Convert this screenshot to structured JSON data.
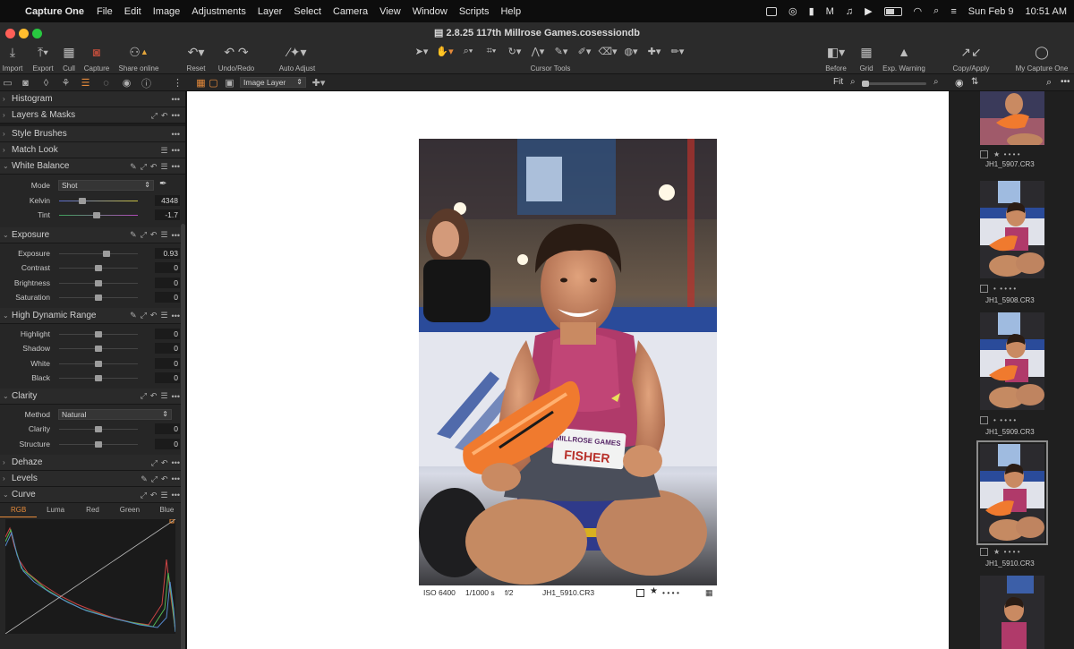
{
  "menubar": {
    "app": "Capture One",
    "items": [
      "File",
      "Edit",
      "Image",
      "Adjustments",
      "Layer",
      "Select",
      "Camera",
      "View",
      "Window",
      "Scripts",
      "Help"
    ],
    "date": "Sun Feb 9",
    "time": "10:51 AM"
  },
  "window": {
    "title": "2.8.25 117th Millrose Games.cosessiondb"
  },
  "toolbar": {
    "import": "Import",
    "export": "Export",
    "cull": "Cull",
    "capture": "Capture",
    "share_online": "Share online",
    "reset": "Reset",
    "undo_redo": "Undo/Redo",
    "auto_adjust": "Auto Adjust",
    "cursor_tools": "Cursor Tools",
    "before": "Before",
    "grid": "Grid",
    "exp_warning": "Exp. Warning",
    "copy_apply": "Copy/Apply",
    "my_capture_one": "My Capture One"
  },
  "viewer_bar": {
    "layer_select": "Image Layer",
    "fit": "Fit"
  },
  "panels": {
    "histogram": "Histogram",
    "layers_masks": "Layers & Masks",
    "style_brushes": "Style Brushes",
    "match_look": "Match Look",
    "white_balance": {
      "title": "White Balance",
      "mode_label": "Mode",
      "mode_value": "Shot",
      "kelvin_label": "Kelvin",
      "kelvin_value": "4348",
      "kelvin_pos": 0.3,
      "tint_label": "Tint",
      "tint_value": "-1.7",
      "tint_pos": 0.48
    },
    "exposure": {
      "title": "Exposure",
      "rows": [
        {
          "label": "Exposure",
          "value": "0.93",
          "pos": 0.6
        },
        {
          "label": "Contrast",
          "value": "0",
          "pos": 0.5
        },
        {
          "label": "Brightness",
          "value": "0",
          "pos": 0.5
        },
        {
          "label": "Saturation",
          "value": "0",
          "pos": 0.5
        }
      ]
    },
    "hdr": {
      "title": "High Dynamic Range",
      "rows": [
        {
          "label": "Highlight",
          "value": "0",
          "pos": 0.5
        },
        {
          "label": "Shadow",
          "value": "0",
          "pos": 0.5
        },
        {
          "label": "White",
          "value": "0",
          "pos": 0.5
        },
        {
          "label": "Black",
          "value": "0",
          "pos": 0.5
        }
      ]
    },
    "clarity": {
      "title": "Clarity",
      "method_label": "Method",
      "method_value": "Natural",
      "rows": [
        {
          "label": "Clarity",
          "value": "0",
          "pos": 0.5
        },
        {
          "label": "Structure",
          "value": "0",
          "pos": 0.5
        }
      ]
    },
    "dehaze": "Dehaze",
    "levels": "Levels",
    "curve": {
      "title": "Curve",
      "tabs": [
        "RGB",
        "Luma",
        "Red",
        "Green",
        "Blue"
      ]
    }
  },
  "photo_caption": {
    "iso": "ISO 6400",
    "shutter": "1/1000 s",
    "aperture": "f/2",
    "filename": "JH1_5910.CR3",
    "rating_star": "★",
    "rating_dots": "• • • •"
  },
  "photo_content": {
    "bib_line1": "MILLROSE GAMES",
    "bib_name": "FISHER"
  },
  "browser": {
    "thumbs": [
      {
        "name": "JH1_5907.CR3",
        "star": "★",
        "dots": "• • • •"
      },
      {
        "name": "JH1_5908.CR3",
        "star": "•",
        "dots": "• • • •"
      },
      {
        "name": "JH1_5909.CR3",
        "star": "•",
        "dots": "• • • •"
      },
      {
        "name": "JH1_5910.CR3",
        "star": "★",
        "dots": "• • • •"
      }
    ]
  },
  "colors": {
    "accent": "#e58a3a",
    "panel_bg": "#262626",
    "viewer_bg": "#ffffff"
  }
}
